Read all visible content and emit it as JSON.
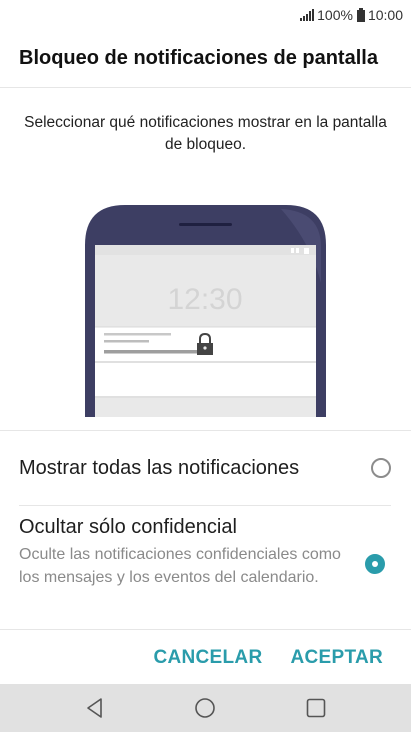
{
  "status_bar": {
    "battery": "100%",
    "time": "10:00"
  },
  "header": {
    "title": "Bloqueo de notificaciones de pantalla"
  },
  "description": "Seleccionar qué notificaciones mostrar en la pantalla de bloqueo.",
  "illustration": {
    "clock": "12:30"
  },
  "options": [
    {
      "label": "Mostrar todas las notificaciones",
      "selected": false
    },
    {
      "label": "Ocultar sólo confidencial",
      "sublabel": "Oculte las notificaciones confidenciales como los mensajes y los eventos del calendario.",
      "selected": true
    }
  ],
  "buttons": {
    "cancel": "CANCELAR",
    "accept": "ACEPTAR"
  },
  "colors": {
    "accent": "#2a9cab",
    "phone_frame": "#3d3e63",
    "navbar": "#e1e1e1"
  },
  "icons": [
    "signal-icon",
    "battery-icon",
    "lock-icon",
    "nav-back-icon",
    "nav-home-icon",
    "nav-recents-icon"
  ]
}
